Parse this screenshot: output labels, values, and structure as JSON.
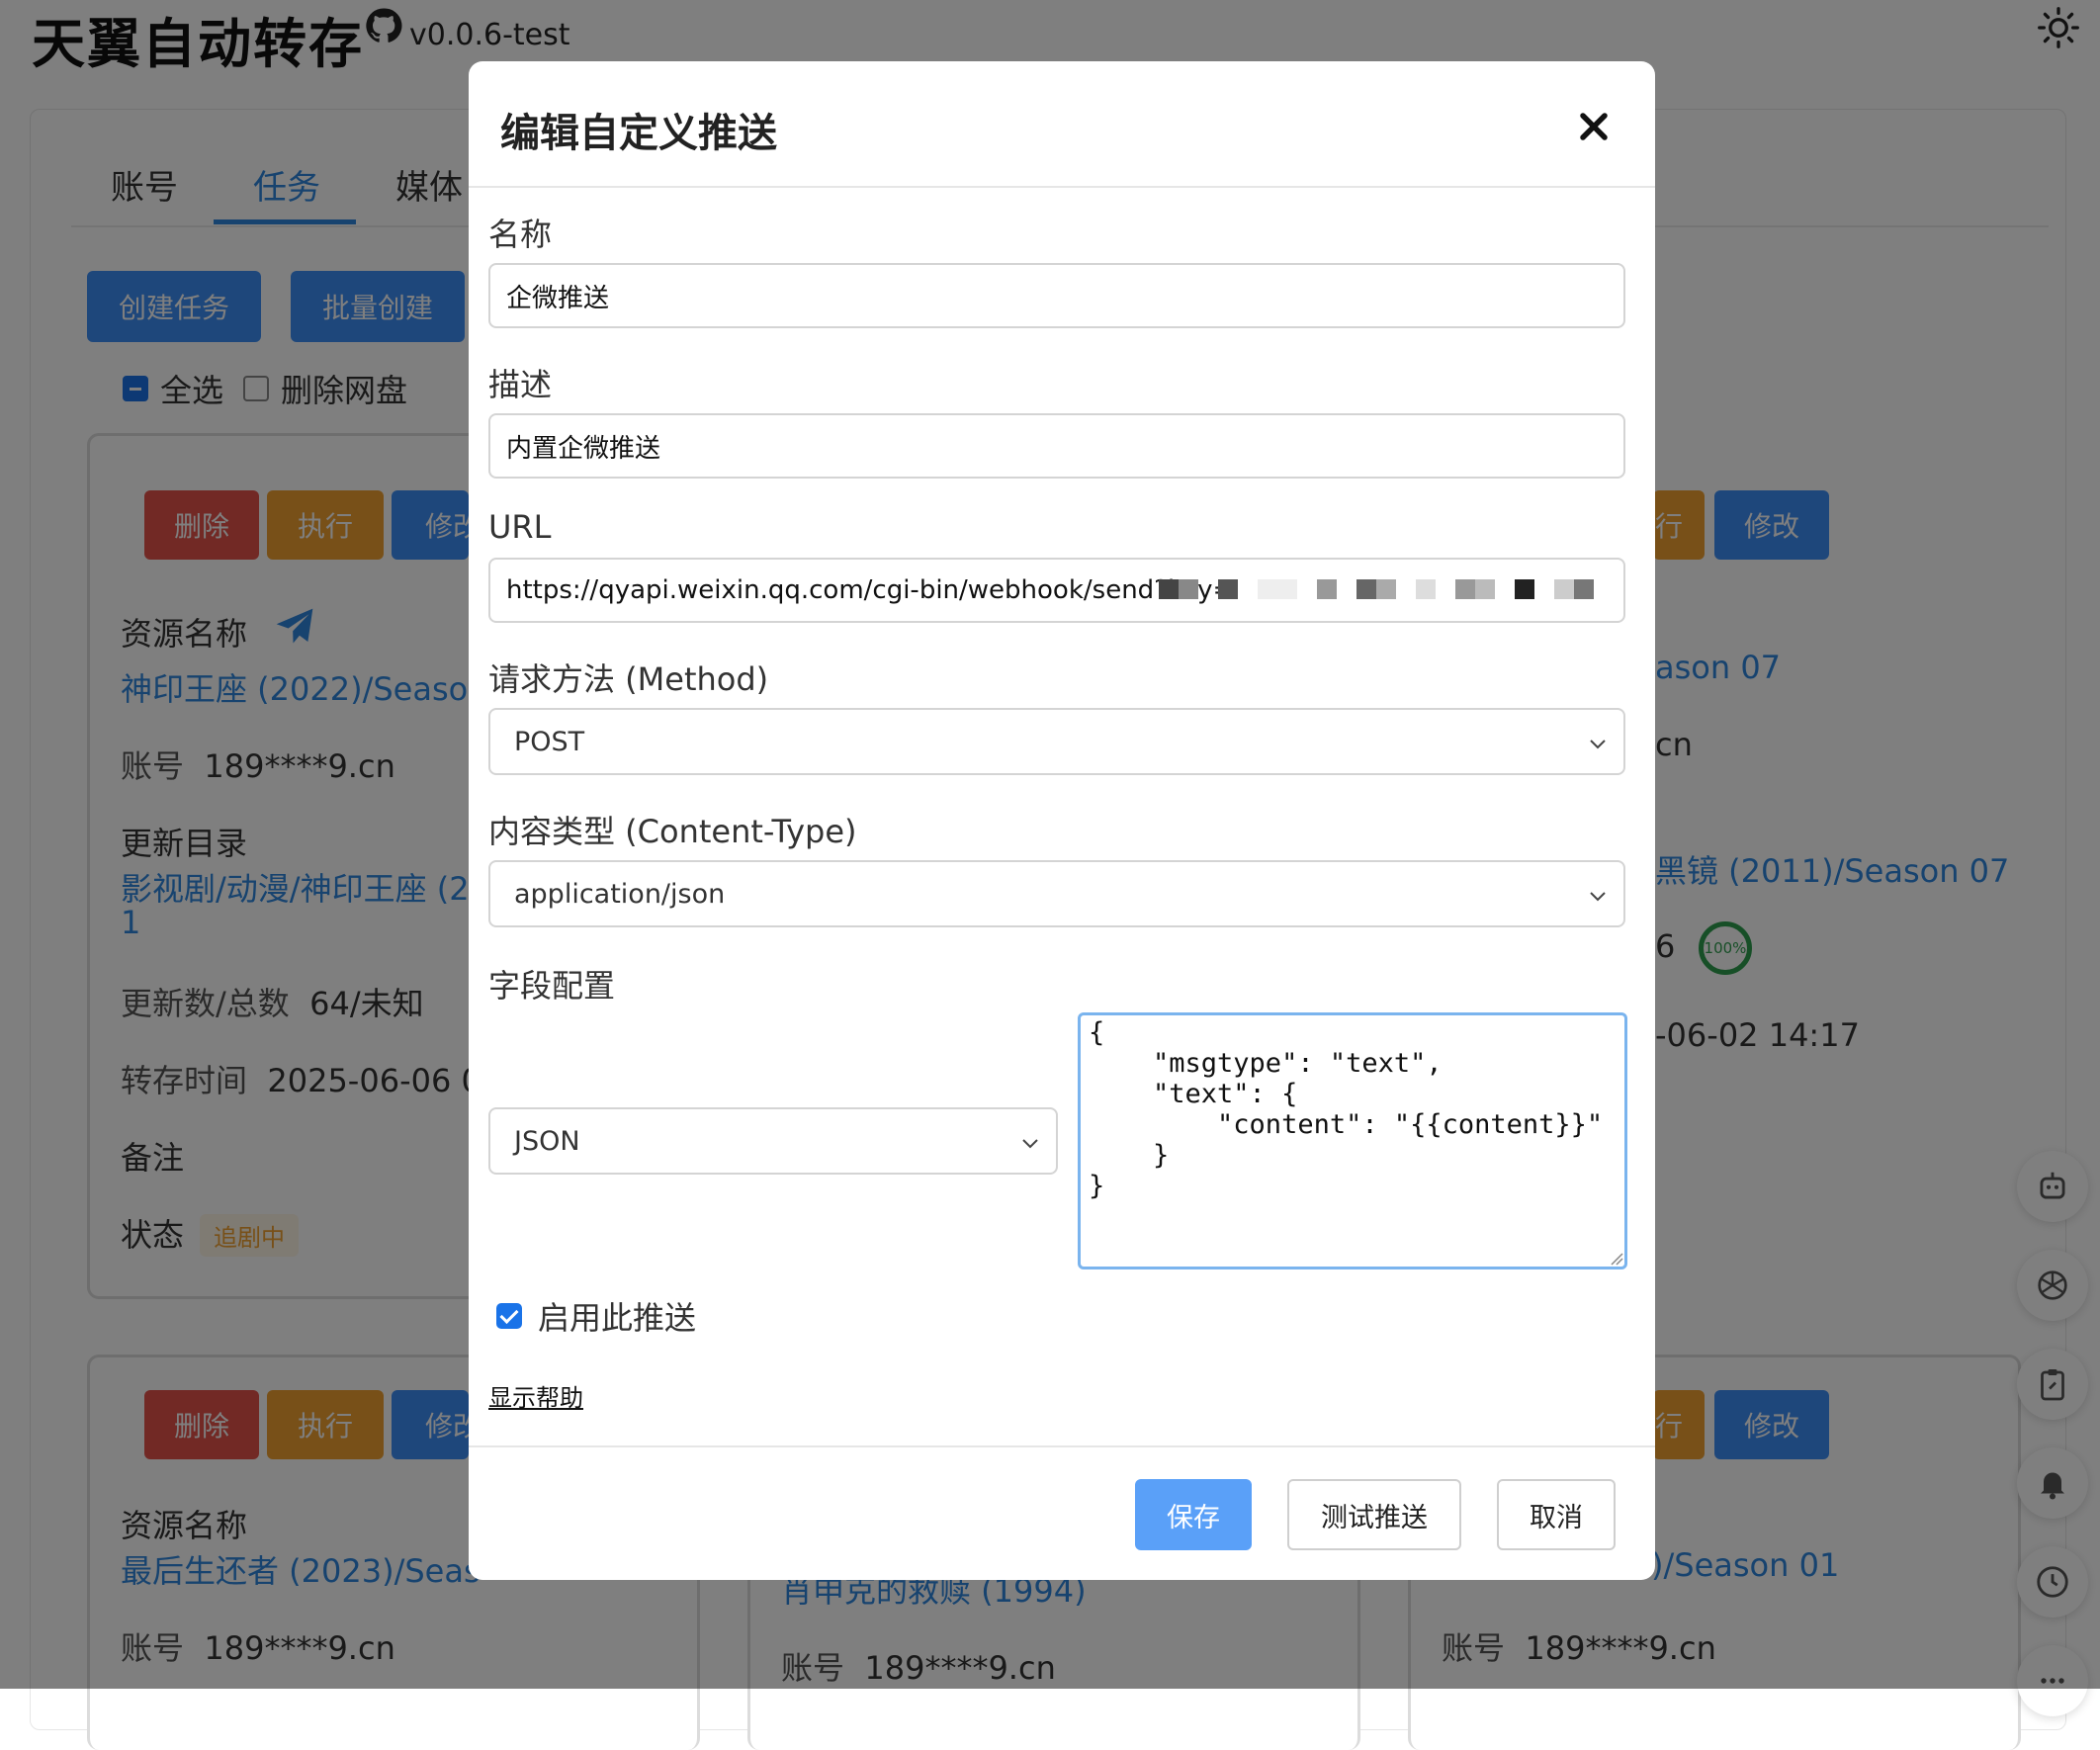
{
  "app": {
    "title": "天翼自动转存",
    "version": "v0.0.6-test"
  },
  "tabs": [
    {
      "label": "账号"
    },
    {
      "label": "任务"
    },
    {
      "label": "媒体"
    }
  ],
  "toolbar": {
    "create_task": "创建任务",
    "batch_create": "批量创建",
    "select_all": "全选",
    "delete_drive": "删除网盘"
  },
  "card_buttons": {
    "delete": "删除",
    "execute": "执行",
    "modify": "修改",
    "modify_partial": "修改",
    "execute_partial": "行"
  },
  "task1": {
    "resource_label": "资源名称",
    "resource_name": "神印王座 (2022)/Season",
    "account_label": "账号",
    "account_value": "189****9.cn",
    "dir_label": "更新目录",
    "dir_value": "影视剧/动漫/神印王座 (20",
    "dir_value_2": "1",
    "count_label": "更新数/总数",
    "count_value": "64/未知",
    "time_label": "转存时间",
    "time_value": "2025-06-06 0",
    "remark_label": "备注",
    "status_label": "状态",
    "status_value": "追剧中"
  },
  "task_right": {
    "resource_name": "ason 07",
    "account_tail": "cn",
    "dir_value": "黑镜 (2011)/Season 07",
    "count_tail": "6",
    "progress_text": "100%",
    "time_value": "-06-02 14:17"
  },
  "task2": {
    "resource_label": "资源名称",
    "resource_name": "最后生还者 (2023)/Seas",
    "account_label": "账号",
    "account_value": "189****9.cn"
  },
  "task3": {
    "resource_name": "肖申克的救赎 (1994)",
    "account_label": "账号",
    "account_value": "189****9.cn"
  },
  "task4": {
    "resource_name": ")/Season 01",
    "account_label": "账号",
    "account_value": "189****9.cn"
  },
  "modal": {
    "title": "编辑自定义推送",
    "name_label": "名称",
    "name_value": "企微推送",
    "desc_label": "描述",
    "desc_value": "内置企微推送",
    "url_label": "URL",
    "url_value": "https://qyapi.weixin.qq.com/cgi-bin/webhook/send?key=",
    "method_label": "请求方法 (Method)",
    "method_value": "POST",
    "content_type_label": "内容类型 (Content-Type)",
    "content_type_value": "application/json",
    "fields_label": "字段配置",
    "fields_format": "JSON",
    "fields_body": "{\n    \"msgtype\": \"text\",\n    \"text\": {\n        \"content\": \"{{content}}\"\n    }\n}",
    "enable_label": "启用此推送",
    "help_link": "显示帮助",
    "save_button": "保存",
    "test_button": "测试推送",
    "cancel_button": "取消"
  },
  "colors": {
    "accent": "#2e86de",
    "danger": "#e5534b",
    "warning": "#f0a030",
    "checkbox": "#1a73e8"
  }
}
